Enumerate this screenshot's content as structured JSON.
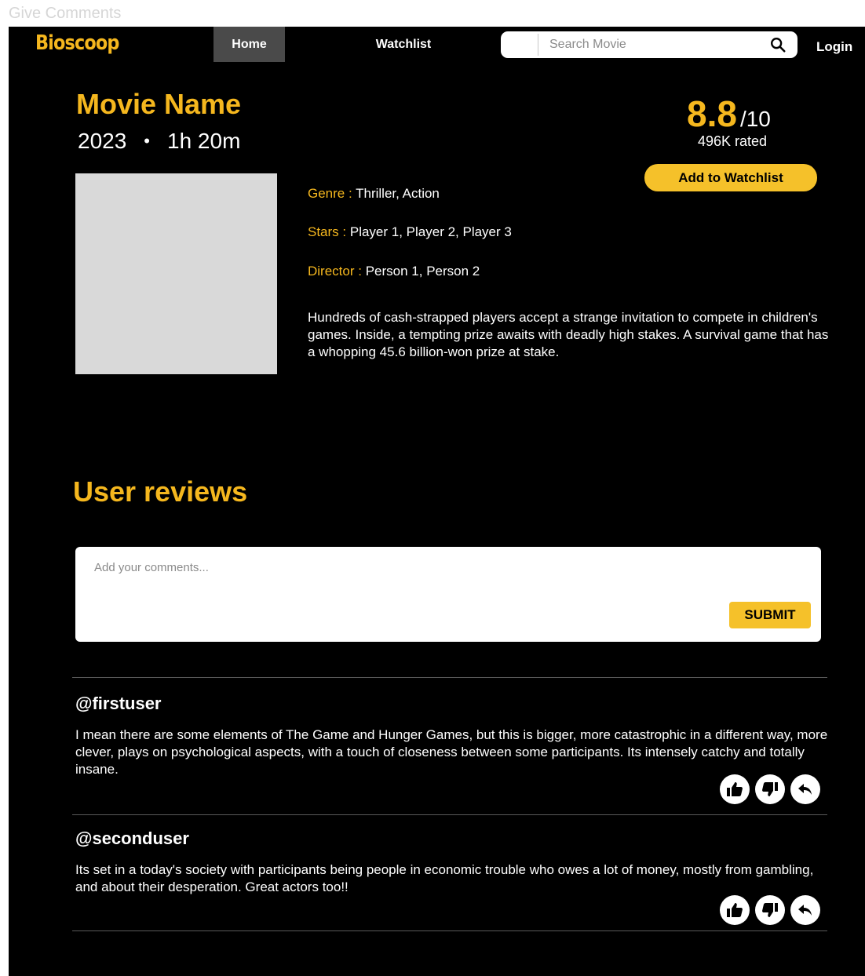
{
  "frame_label": "Give Comments",
  "nav": {
    "logo": "Bioscoop",
    "home": "Home",
    "watchlist": "Watchlist",
    "search_placeholder": "Search Movie",
    "login": "Login"
  },
  "movie": {
    "title": "Movie Name",
    "year": "2023",
    "separator": "•",
    "duration": "1h 20m",
    "rating": "8.8",
    "rating_out_of": "/10",
    "rated_count": "496K rated",
    "add_watchlist_label": "Add to Watchlist",
    "genre_label": "Genre :",
    "genre": "Thriller, Action",
    "stars_label": "Stars :",
    "stars": "Player 1, Player 2, Player 3",
    "director_label": "Director :",
    "director": "Person 1, Person 2",
    "synopsis": "Hundreds of cash-strapped players accept a strange invitation to compete in children's games. Inside, a tempting prize awaits with deadly high stakes. A survival game that has a whopping 45.6 billion-won prize at stake."
  },
  "reviews": {
    "title": "User reviews",
    "comment_placeholder": "Add your comments...",
    "submit_label": "SUBMIT",
    "items": [
      {
        "user": "@firstuser",
        "text": "I mean there are some elements of The Game and Hunger Games, but this is bigger, more catastrophic in a different way, more clever, plays on psychological aspects, with a touch of closeness between some participants. Its intensely catchy and totally insane."
      },
      {
        "user": "@seconduser",
        "text": "Its set in a today's society with participants being people in economic trouble who owes a lot of money, mostly from gambling, and about their desperation. Great actors too!!"
      }
    ],
    "action_icons": [
      "thumbs-up-icon",
      "thumbs-down-icon",
      "reply-icon"
    ]
  },
  "colors": {
    "accent": "#f5b71e",
    "button": "#f5c12a",
    "background": "#000000",
    "poster_placeholder": "#d9d9d9"
  }
}
